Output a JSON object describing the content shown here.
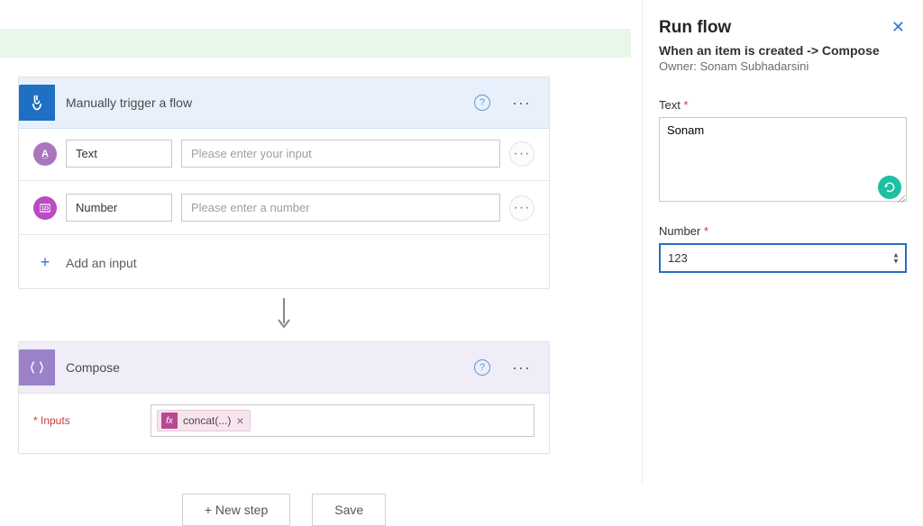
{
  "banner": {},
  "trigger": {
    "title": "Manually trigger a flow",
    "inputs": [
      {
        "label": "Text",
        "placeholder": "Please enter your input"
      },
      {
        "label": "Number",
        "placeholder": "Please enter a number"
      }
    ],
    "add_input_label": "Add an input"
  },
  "compose": {
    "title": "Compose",
    "inputs_label": "* Inputs",
    "token": "concat(...)"
  },
  "buttons": {
    "new_step": "+ New step",
    "save": "Save"
  },
  "panel": {
    "title": "Run flow",
    "subtitle": "When an item is created -> Compose",
    "owner_line": "Owner: Sonam Subhadarsini",
    "text_label": "Text",
    "text_value": "Sonam",
    "number_label": "Number",
    "number_value": "123",
    "required_mark": "*"
  }
}
